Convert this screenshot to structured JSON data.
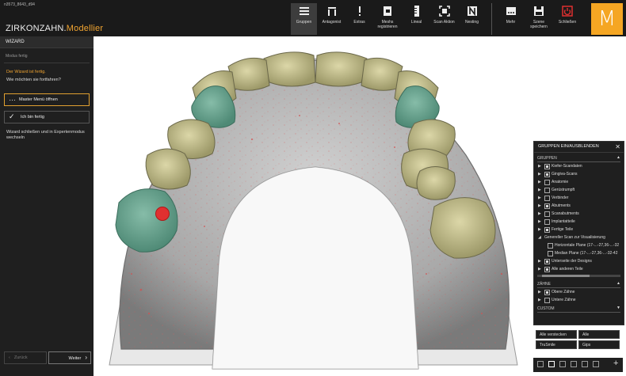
{
  "file_name": "n3573_8643_d94",
  "app": {
    "title_main": "ZIRKONZAHN.",
    "title_accent": "Modellier"
  },
  "toolbar": [
    {
      "id": "gruppen",
      "label": "Gruppen",
      "active": true
    },
    {
      "id": "antagonist",
      "label": "Antagonist"
    },
    {
      "id": "extras",
      "label": "Extras"
    },
    {
      "id": "meshs",
      "label": "Meshs registrieren"
    },
    {
      "id": "lineal",
      "label": "Lineal"
    },
    {
      "id": "scan_aktion",
      "label": "Scan Aktion"
    },
    {
      "id": "nesting",
      "label": "Nesting"
    },
    {
      "id": "mehr",
      "label": "Mehr"
    },
    {
      "id": "szene",
      "label": "Szene speichern"
    },
    {
      "id": "schliessen",
      "label": "Schließen"
    }
  ],
  "logo_letter": "M",
  "wizard": {
    "header": "WIZARD",
    "subtitle": "Modus fertig",
    "done_text": "Der Wizard ist fertig.",
    "question": "Wie möchten sie fortfahren?",
    "btn_master": "Master Menü öffnen",
    "btn_done": "Ich bin fertig",
    "note": "Wizard schließen und in Expertenmodus wechseln",
    "back": "Zurück",
    "next": "Weiter"
  },
  "groups_panel": {
    "title": "GRUPPEN EIN/AUSBLENDEN",
    "section_groups": "GRUPPEN",
    "items": [
      {
        "label": "Kiefer-Scandaten",
        "checked": true,
        "expand": true
      },
      {
        "label": "Gingiva-Scans",
        "checked": true,
        "expand": true
      },
      {
        "label": "Anatomie",
        "checked": false,
        "expand": true
      },
      {
        "label": "Gerüstrumpft",
        "checked": false,
        "expand": true
      },
      {
        "label": "Verbinder",
        "checked": false,
        "expand": true
      },
      {
        "label": "Abutments",
        "checked": true,
        "expand": true
      },
      {
        "label": "Scanabutments",
        "checked": false,
        "expand": true
      },
      {
        "label": "Implantatteile",
        "checked": false,
        "expand": true
      },
      {
        "label": "Fertige Teile",
        "checked": true,
        "expand": true
      }
    ],
    "sub_header": "Genereller Scan zur Visualisierung",
    "sub_items": [
      {
        "label": "Horizontale Plane (17-...-27,36-...-32",
        "checked": false
      },
      {
        "label": "Median Plane (17-...-27,36-...-32-42",
        "checked": false
      }
    ],
    "more_items": [
      {
        "label": "Unterseite der Designs",
        "checked": true
      },
      {
        "label": "Alle anderen Teile",
        "checked": true
      }
    ],
    "section_teeth": "ZÄHNE",
    "teeth_items": [
      {
        "label": "Obere Zähne",
        "checked": true
      },
      {
        "label": "Untere Zähne",
        "checked": false
      }
    ],
    "section_custom": "CUSTOM",
    "buttons": {
      "hide_all": "Alle verstecken",
      "all": "Alle",
      "trusmile": "TruSmile",
      "gips": "Gips"
    }
  },
  "colors": {
    "accent": "#f2a531",
    "logo_bg": "#f5a623",
    "tooth_yellow": "#cbc695",
    "tooth_green": "#6fa895",
    "marker_red": "#e03030"
  }
}
